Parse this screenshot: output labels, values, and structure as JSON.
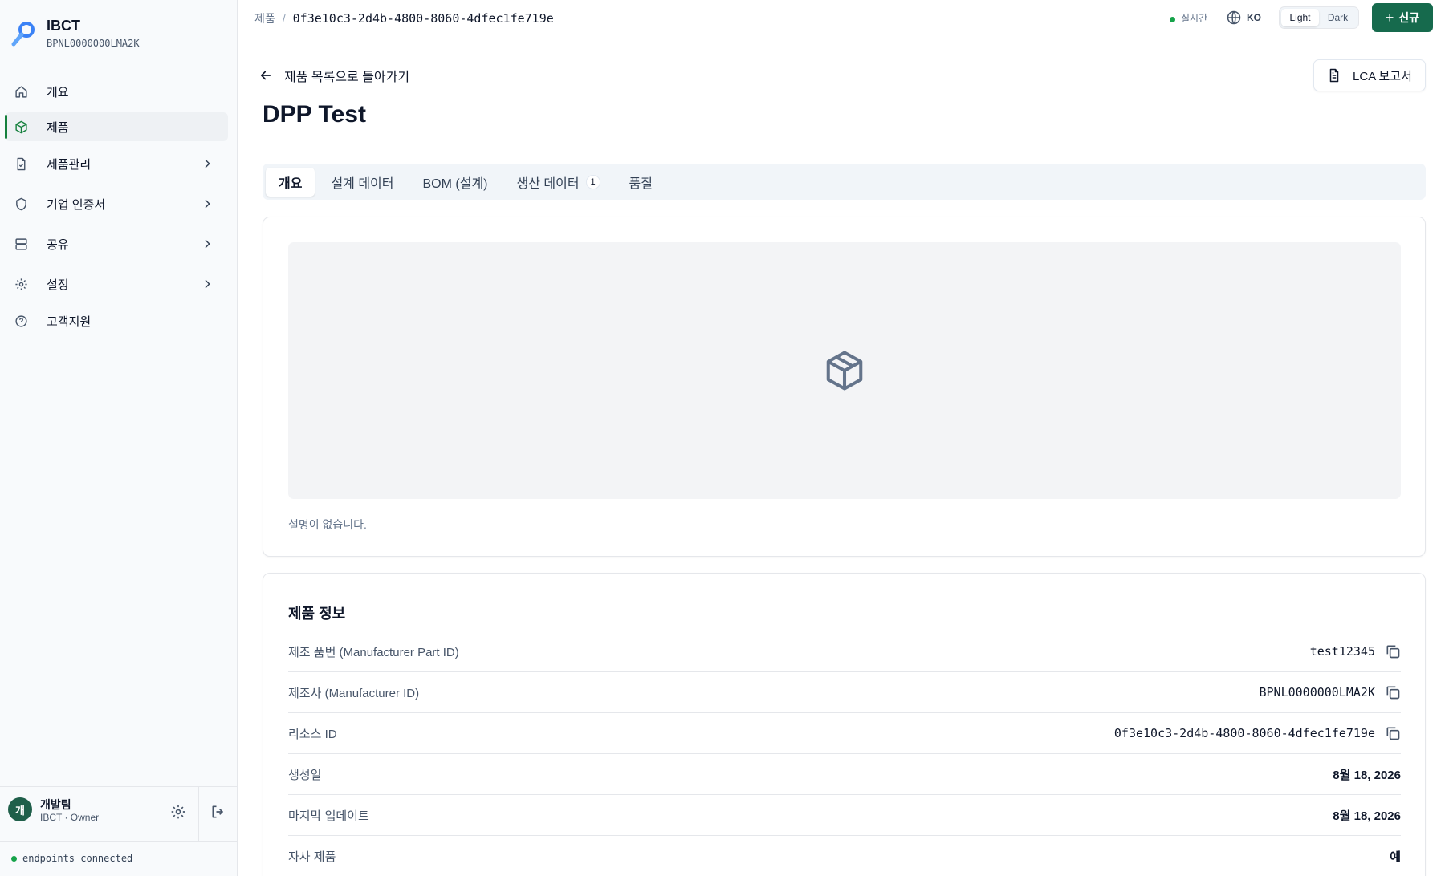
{
  "brand": {
    "name": "IBCT",
    "id": "BPNL0000000LMA2K"
  },
  "sidebar": {
    "items": [
      {
        "label": "개요",
        "icon": "home-icon"
      },
      {
        "label": "제품",
        "icon": "cube-icon",
        "active": true
      },
      {
        "label": "제품관리",
        "icon": "file-check-icon",
        "expandable": true
      },
      {
        "label": "기업 인증서",
        "icon": "shield-icon",
        "expandable": true
      },
      {
        "label": "공유",
        "icon": "server-icon",
        "expandable": true
      },
      {
        "label": "설정",
        "icon": "gear-icon",
        "expandable": true
      },
      {
        "label": "고객지원",
        "icon": "help-circle-icon"
      }
    ],
    "user": {
      "avatar": "개",
      "name": "개발팀",
      "role": "IBCT · Owner"
    },
    "connection": "endpoints connected"
  },
  "topbar": {
    "breadcrumb_root": "제품",
    "breadcrumb_separator": "/",
    "breadcrumb_current": "0f3e10c3-2d4b-4800-8060-4dfec1fe719e",
    "live_label": "실시간",
    "lang": "KO",
    "theme_light": "Light",
    "theme_dark": "Dark",
    "new_button": "신규",
    "new_plus": "+"
  },
  "page": {
    "back_label": "제품 목록으로 돌아가기",
    "lca_button": "LCA 보고서",
    "title": "DPP Test",
    "tabs": [
      {
        "label": "개요",
        "active": true
      },
      {
        "label": "설계 데이터"
      },
      {
        "label": "BOM (설계)"
      },
      {
        "label": "생산 데이터",
        "badge": "1"
      },
      {
        "label": "품질"
      }
    ],
    "description": "설명이 없습니다.",
    "info_title": "제품 정보",
    "info_rows": [
      {
        "key": "제조 품번 (Manufacturer Part ID)",
        "value": "test12345",
        "mono": true,
        "copy": true
      },
      {
        "key": "제조사 (Manufacturer ID)",
        "value": "BPNL0000000LMA2K",
        "mono": true,
        "copy": true
      },
      {
        "key": "리소스 ID",
        "value": "0f3e10c3-2d4b-4800-8060-4dfec1fe719e",
        "mono": true,
        "copy": true
      },
      {
        "key": "생성일",
        "value": "8월 18, 2026"
      },
      {
        "key": "마지막 업데이트",
        "value": "8월 18, 2026"
      },
      {
        "key": "자사 제품",
        "value": "예"
      }
    ]
  },
  "colors": {
    "accent": "#166a4d",
    "status_green": "#16a34a"
  }
}
